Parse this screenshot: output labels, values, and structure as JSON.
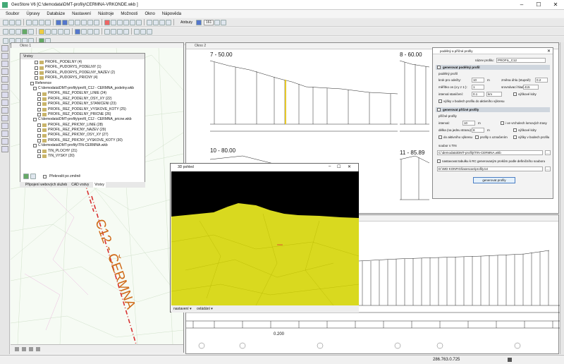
{
  "app": {
    "title": "GeoStore V6 [C:\\demodata\\DMT-profily\\CERMNA-VRKONDE.wkb ]"
  },
  "menu": [
    "Soubor",
    "Úpravy",
    "Databáze",
    "Nastavení",
    "Nástroje",
    "Možnosti",
    "Okno",
    "Nápověda"
  ],
  "toolbar": {
    "attributes_label": "Atributy",
    "width_value": "161"
  },
  "map_window": {
    "title": "Okno 1",
    "label": "C12 - ČERMNA",
    "scale_value": "0.200"
  },
  "layers": {
    "title": "Vrstvy",
    "items": [
      "PROFIL_PODELNY (4)",
      "PROFIL_PUDORYS_PODELNY (1)",
      "PROFIL_PUDORYS_PODELNY_NAZEV (2)",
      "PROFIL_PUDORYS_PRICNY (4)",
      "Reference",
      "C:\\demodata\\DMT-profily\\profil_C12 - CERMNA_podelny.wkb",
      "PROFIL_REZ_PODELNY_LINIE (24)",
      "PROFIL_REZ_PODELNY_OSY_XY (22)",
      "PROFIL_REZ_PODELNY_STANICENI (23)",
      "PROFIL_REZ_PODELNY_VYSKOVE_KOTY (25)",
      "PROFIL_REZ_PODELNY_PRICNE (26)",
      "C:\\demodata\\DMT-profily\\profil_C12 - CERMNA_pricne.wkb",
      "PROFIL_REZ_PRICNY_LINIE (28)",
      "PROFIL_REZ_PRICNY_NAZEV (29)",
      "PROFIL_REZ_PRICNY_OSY_XY (27)",
      "PROFIL_REZ_PRICNY_VYSKOVE_KOTY (30)",
      "C:\\demodata\\DMT-profily\\TIN-CERMNA.wkb",
      "TIN_PLOCHY (21)",
      "TIN_VYSKY (20)"
    ],
    "redraw_label": "Překreslit po změně",
    "tabs": [
      "Připojení webových služeb",
      "CAD vrstvy",
      "Vrstvy"
    ]
  },
  "profile_window": {
    "title": "Okno 2",
    "labels": [
      "7 - 50.00",
      "8 - 60.00",
      "10 - 80.00",
      "11 - 85.89"
    ]
  },
  "dialog": {
    "title": "podélný a příčné profily",
    "nazev_label": "název profilu:",
    "nazev_value": "PROFIL_C12",
    "gen_podelny": "generovat podélný profil",
    "podelny_label": "podélný profil",
    "krok_label": "krok pro odečty:",
    "krok_value": "10",
    "krok_unit": "m",
    "zmena_label": "změna úhlu (stupně):",
    "zmena_value": "0.2",
    "meritko_label": "měřítko os (x:y z 1:):",
    "meritko_value": "1",
    "srovnavaci_label": "srovnávací hladina:",
    "srovnavaci_value": "415",
    "interval_label": "interval staničení:",
    "interval_value": "0.1",
    "interval_unit": "km",
    "vyskove_koty": "výškové kóty",
    "vyskove_bodech": "výšky v bodech profilu do aktivního výkresu",
    "gen_pricne": "generovat příčné profily",
    "pricne_label": "příčné profily",
    "p_interval_label": "interval:",
    "p_interval_value": "10",
    "p_interval_unit": "m",
    "vrcholy_label": "i ve vrcholech lomových trasy",
    "delka_label": "délka (na jednu stranu):",
    "delka_value": "8",
    "delka_unit": "m",
    "p_vyskove_koty": "výškové kóty",
    "aktivni_label": "do aktivního výkresu",
    "oznacenim_label": "profily s označením",
    "bodech_label": "výšky v bodech profilu",
    "tin_label": "soubor s TIN",
    "tin_value": "C:\\demodata\\DMT-profily\\TIN-CERMNA.wkb",
    "tabulka_label": "nastavovat tabulku k RC generovaným prvkům podle definičního souboru",
    "tabulka_value": "D:\\WD-KONFIG\\lasescan\\profily.txt",
    "gen_button": "generovat profily"
  },
  "view3d": {
    "title": "3D pohled",
    "menu1": "nastavení ▾",
    "menu2": "ovládání ▾"
  },
  "status": {
    "coords": "286.763.0.725"
  }
}
